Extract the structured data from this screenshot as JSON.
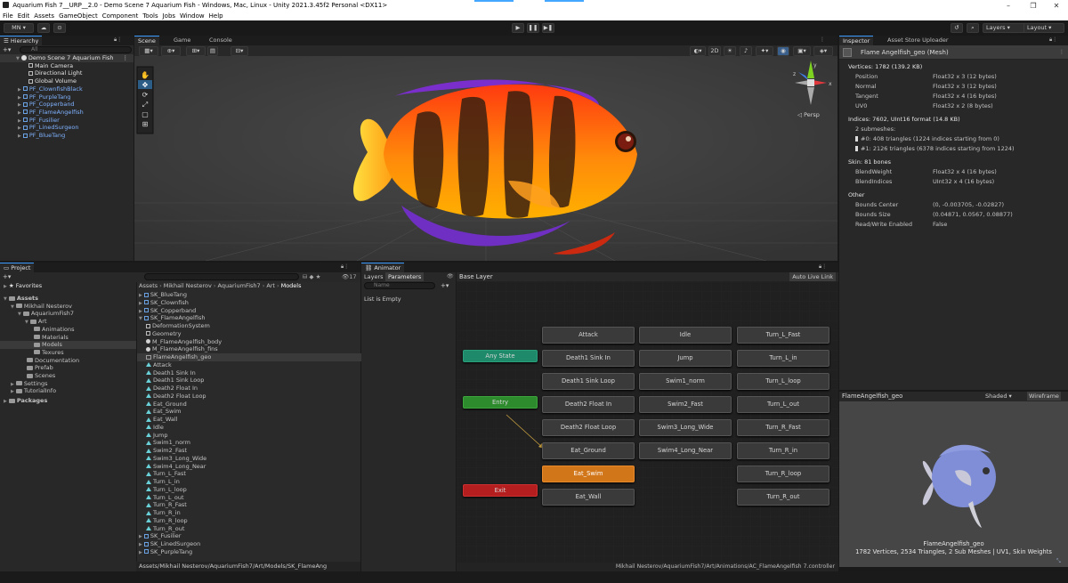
{
  "window": {
    "title": "Aquarium Fish 7__URP__2.0 - Demo Scene 7 Aquarium Fish - Windows, Mac, Linux - Unity 2021.3.45f2 Personal <DX11>",
    "minimize": "–",
    "maximize": "❐",
    "close": "✕"
  },
  "menu": [
    "File",
    "Edit",
    "Assets",
    "GameObject",
    "Component",
    "Tools",
    "Jobs",
    "Window",
    "Help"
  ],
  "toolbar": {
    "account": "MN ▾",
    "layers": "Layers",
    "layout": "Layout"
  },
  "hierarchy": {
    "tab": "Hierarchy",
    "search": "All",
    "items": [
      {
        "label": "Demo Scene 7 Aquarium Fish",
        "level": 0,
        "kind": "scene"
      },
      {
        "label": "Main Camera",
        "level": 1,
        "kind": "go"
      },
      {
        "label": "Directional Light",
        "level": 1,
        "kind": "go"
      },
      {
        "label": "Global Volume",
        "level": 1,
        "kind": "go"
      },
      {
        "label": "PF_ClownfishBlack",
        "level": 1,
        "kind": "prefab"
      },
      {
        "label": "PF_PurpleTang",
        "level": 1,
        "kind": "prefab"
      },
      {
        "label": "PF_Copperband",
        "level": 1,
        "kind": "prefab"
      },
      {
        "label": "PF_FlameAngelfish",
        "level": 1,
        "kind": "prefab"
      },
      {
        "label": "PF_Fusilier",
        "level": 1,
        "kind": "prefab"
      },
      {
        "label": "PF_LinedSurgeon",
        "level": 1,
        "kind": "prefab"
      },
      {
        "label": "PF_BlueTang",
        "level": 1,
        "kind": "prefab"
      }
    ]
  },
  "scene": {
    "tabs": [
      "Scene",
      "Game",
      "Console"
    ],
    "mode_2d": "2D",
    "persp": "◁ Persp",
    "gizmo_y": "y",
    "gizmo_x": "x",
    "gizmo_z": "z"
  },
  "inspector": {
    "tabs": [
      "Inspector",
      "Asset Store Uploader"
    ],
    "object": "Flame Angelfish_geo (Mesh)",
    "vertices_header": "Vertices: 1782 (139.2 KB)",
    "vertex_attrs": [
      {
        "name": "Position",
        "value": "Float32 x 3 (12 bytes)"
      },
      {
        "name": "Normal",
        "value": "Float32 x 3 (12 bytes)"
      },
      {
        "name": "Tangent",
        "value": "Float32 x 4 (16 bytes)"
      },
      {
        "name": "UV0",
        "value": "Float32 x 2 (8 bytes)"
      }
    ],
    "indices_header": "Indices: 7602, UInt16 format (14.8 KB)",
    "submeshes": "2 submeshes:",
    "submesh_rows": [
      "#0: 408 triangles (1224 indices starting from 0)",
      "#1: 2126 triangles (6378 indices starting from 1224)"
    ],
    "skin_header": "Skin: 81 bones",
    "skin_rows": [
      {
        "name": "BlendWeight",
        "value": "Float32 x 4 (16 bytes)"
      },
      {
        "name": "BlendIndices",
        "value": "UInt32 x 4 (16 bytes)"
      }
    ],
    "other_header": "Other",
    "other_rows": [
      {
        "name": "Bounds Center",
        "value": "(0, -0.003705, -0.02827)"
      },
      {
        "name": "Bounds Size",
        "value": "(0.04871, 0.0567, 0.08877)"
      },
      {
        "name": "Read/Write Enabled",
        "value": "False"
      }
    ]
  },
  "preview": {
    "name": "FlameAngelfish_geo",
    "shaded": "Shaded",
    "wireframe": "Wireframe",
    "caption_name": "FlameAngelfish_geo",
    "caption_info": "1782 Vertices, 2534 Triangles, 2 Sub Meshes | UV1, Skin Weights"
  },
  "project": {
    "tab": "Project",
    "favorites": "Favorites",
    "tree": [
      {
        "label": "Assets",
        "level": 0,
        "bold": true
      },
      {
        "label": "Mikhail Nesterov",
        "level": 1
      },
      {
        "label": "AquariumFish7",
        "level": 2
      },
      {
        "label": "Art",
        "level": 3
      },
      {
        "label": "Animations",
        "level": 4
      },
      {
        "label": "Materials",
        "level": 4
      },
      {
        "label": "Models",
        "level": 4,
        "selected": true
      },
      {
        "label": "Texures",
        "level": 4
      },
      {
        "label": "Documentation",
        "level": 3
      },
      {
        "label": "Prefab",
        "level": 3
      },
      {
        "label": "Scenes",
        "level": 3
      },
      {
        "label": "Settings",
        "level": 1
      },
      {
        "label": "TutorialInfo",
        "level": 1
      },
      {
        "label": "Packages",
        "level": 0,
        "bold": true
      }
    ],
    "count": "17",
    "breadcrumb": [
      "Assets",
      "Mikhail Nesterov",
      "AquariumFish7",
      "Art",
      "Models"
    ],
    "files": [
      {
        "label": "SK_BlueTang",
        "level": 0,
        "kind": "model"
      },
      {
        "label": "SK_Clownfish",
        "level": 0,
        "kind": "model"
      },
      {
        "label": "SK_Copperband",
        "level": 0,
        "kind": "model"
      },
      {
        "label": "SK_FlameAngelfish",
        "level": 0,
        "kind": "model"
      },
      {
        "label": "DeformationSystem",
        "level": 1,
        "kind": "go"
      },
      {
        "label": "Geometry",
        "level": 1,
        "kind": "go"
      },
      {
        "label": "M_FlameAngelfish_body",
        "level": 1,
        "kind": "mat"
      },
      {
        "label": "M_FlameAngelfish_fins",
        "level": 1,
        "kind": "mat"
      },
      {
        "label": "FlameAngelfish_geo",
        "level": 1,
        "kind": "mesh",
        "selected": true
      },
      {
        "label": "Attack",
        "level": 1,
        "kind": "anim"
      },
      {
        "label": "Death1 Sink In",
        "level": 1,
        "kind": "anim"
      },
      {
        "label": "Death1 Sink Loop",
        "level": 1,
        "kind": "anim"
      },
      {
        "label": "Death2 Float In",
        "level": 1,
        "kind": "anim"
      },
      {
        "label": "Death2 Float Loop",
        "level": 1,
        "kind": "anim"
      },
      {
        "label": "Eat_Ground",
        "level": 1,
        "kind": "anim"
      },
      {
        "label": "Eat_Swim",
        "level": 1,
        "kind": "anim"
      },
      {
        "label": "Eat_Wall",
        "level": 1,
        "kind": "anim"
      },
      {
        "label": "Idle",
        "level": 1,
        "kind": "anim"
      },
      {
        "label": "Jump",
        "level": 1,
        "kind": "anim"
      },
      {
        "label": "Swim1_norm",
        "level": 1,
        "kind": "anim"
      },
      {
        "label": "Swim2_Fast",
        "level": 1,
        "kind": "anim"
      },
      {
        "label": "Swim3_Long_Wide",
        "level": 1,
        "kind": "anim"
      },
      {
        "label": "Swim4_Long_Near",
        "level": 1,
        "kind": "anim"
      },
      {
        "label": "Turn_L_Fast",
        "level": 1,
        "kind": "anim"
      },
      {
        "label": "Turn_L_in",
        "level": 1,
        "kind": "anim"
      },
      {
        "label": "Turn_L_loop",
        "level": 1,
        "kind": "anim"
      },
      {
        "label": "Turn_L_out",
        "level": 1,
        "kind": "anim"
      },
      {
        "label": "Turn_R_Fast",
        "level": 1,
        "kind": "anim"
      },
      {
        "label": "Turn_R_in",
        "level": 1,
        "kind": "anim"
      },
      {
        "label": "Turn_R_loop",
        "level": 1,
        "kind": "anim"
      },
      {
        "label": "Turn_R_out",
        "level": 1,
        "kind": "anim"
      },
      {
        "label": "SK_Fusilier",
        "level": 0,
        "kind": "model"
      },
      {
        "label": "SK_LinedSurgeon",
        "level": 0,
        "kind": "model"
      },
      {
        "label": "SK_PurpleTang",
        "level": 0,
        "kind": "model"
      }
    ],
    "status_path": "Assets/Mikhail Nesterov/AquariumFish7/Art/Models/SK_FlameAng"
  },
  "animator": {
    "tab": "Animator",
    "layers_tab": "Layers",
    "params_tab": "Parameters",
    "layer": "Base Layer",
    "auto_live": "Auto Live Link",
    "name_placeholder": "Name",
    "list_empty": "List is Empty",
    "status_path": "Mikhail Nesterov/AquariumFish7/Art/Animations/AC_FlameAngelfish 7.controller",
    "any_state": "Any State",
    "entry": "Entry",
    "exit": "Exit",
    "col1": [
      "Attack",
      "Death1 Sink In",
      "Death1 Sink Loop",
      "Death2 Float In",
      "Death2 Float Loop",
      "Eat_Ground",
      "Eat_Swim",
      "Eat_Wall"
    ],
    "col2": [
      "Idle",
      "Jump",
      "Swim1_norm",
      "Swim2_Fast",
      "Swim3_Long_Wide",
      "Swim4_Long_Near"
    ],
    "col3": [
      "Turn_L_Fast",
      "Turn_L_in",
      "Turn_L_loop",
      "Turn_L_out",
      "Turn_R_Fast",
      "Turn_R_in",
      "Turn_R_loop",
      "Turn_R_out"
    ],
    "default_state": "Eat_Swim"
  }
}
